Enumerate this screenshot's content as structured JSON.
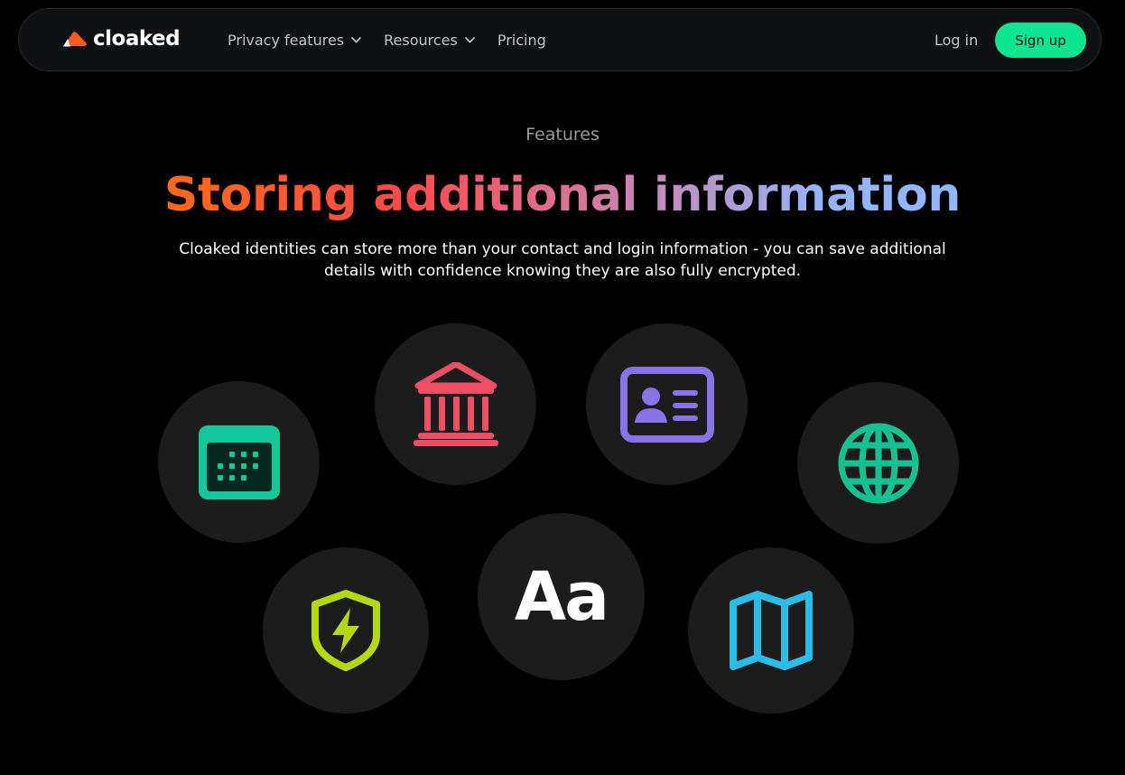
{
  "nav": {
    "logo_text": "cloaked",
    "links": [
      "Privacy features",
      "Resources",
      "Pricing"
    ],
    "login": "Log in",
    "signup": "Sign up"
  },
  "hero": {
    "eyebrow": "Features",
    "headline": "Storing additional information",
    "subtitle_line1": "Cloaked identities can store more than your contact and login information - you can save additional",
    "subtitle_line2": "details with confidence knowing they are also fully encrypted."
  },
  "icons": [
    {
      "name": "calendar-icon",
      "color": "#14c79a"
    },
    {
      "name": "bank-icon",
      "color": "#ee4f65"
    },
    {
      "name": "id-card-icon",
      "color": "#8a73e6"
    },
    {
      "name": "globe-icon",
      "color": "#15c190"
    },
    {
      "name": "shield-bolt-icon",
      "color": "#b5d80b"
    },
    {
      "name": "font-icon",
      "label": "Aa",
      "color": "#ffffff"
    },
    {
      "name": "map-icon",
      "color": "#2bbce8"
    }
  ],
  "colors": {
    "background": "#000000",
    "accent": "#0ee592",
    "logo_mark": "#ff5a1f"
  }
}
